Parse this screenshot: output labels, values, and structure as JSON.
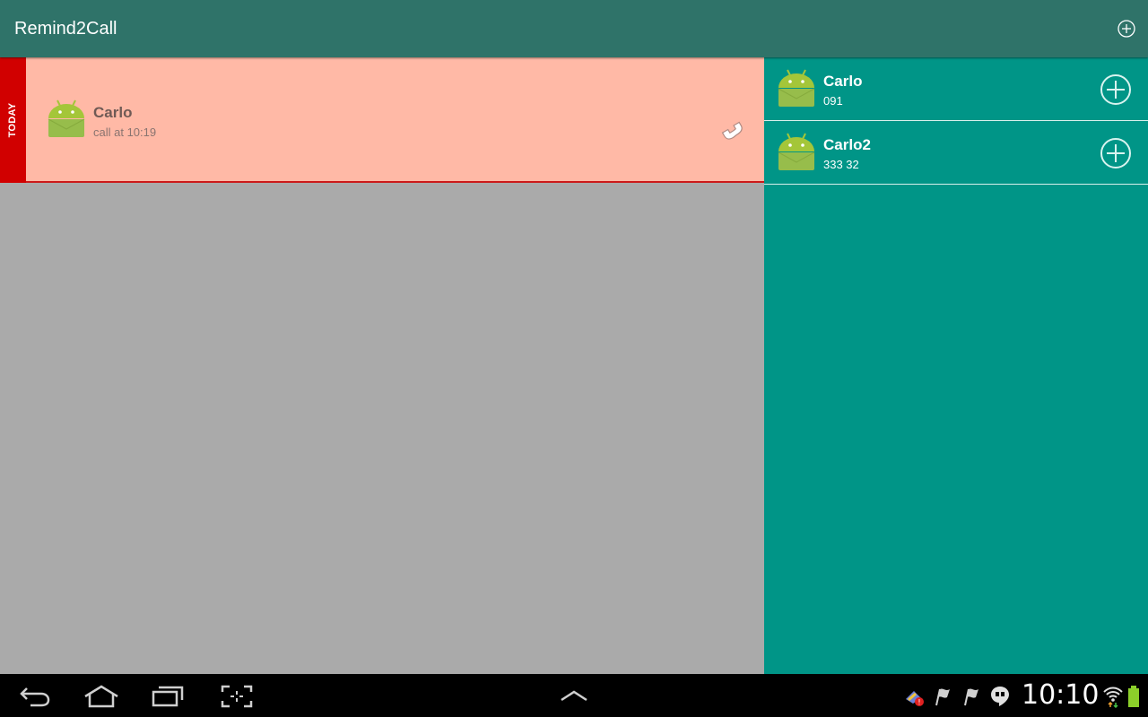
{
  "app": {
    "title": "Remind2Call",
    "add_icon": "add-circle-icon"
  },
  "reminders": [
    {
      "section_label": "TODAY",
      "name": "Carlo",
      "subtitle": "call at 10:19",
      "avatar_icon": "android-icon",
      "action_icon": "phone-icon"
    }
  ],
  "contacts": [
    {
      "name": "Carlo",
      "number": "091",
      "avatar_icon": "android-icon",
      "action_icon": "add-circle-icon"
    },
    {
      "name": "Carlo2",
      "number": "333 32",
      "avatar_icon": "android-icon",
      "action_icon": "add-circle-icon"
    }
  ],
  "system_bar": {
    "time": "10:10",
    "nav_icons": [
      "back-icon",
      "home-icon",
      "recent-apps-icon",
      "screenshot-icon",
      "expand-up-icon"
    ],
    "status_icons": [
      "notification-alert-icon",
      "flag-icon",
      "flag-icon",
      "hangouts-icon",
      "wifi-icon",
      "battery-icon"
    ]
  },
  "colors": {
    "action_bar": "#2f7369",
    "side_panel": "#009587",
    "reminder_bg": "#ffb9a6",
    "today_strip": "#d10000",
    "main_bg": "#aaaaaa"
  }
}
